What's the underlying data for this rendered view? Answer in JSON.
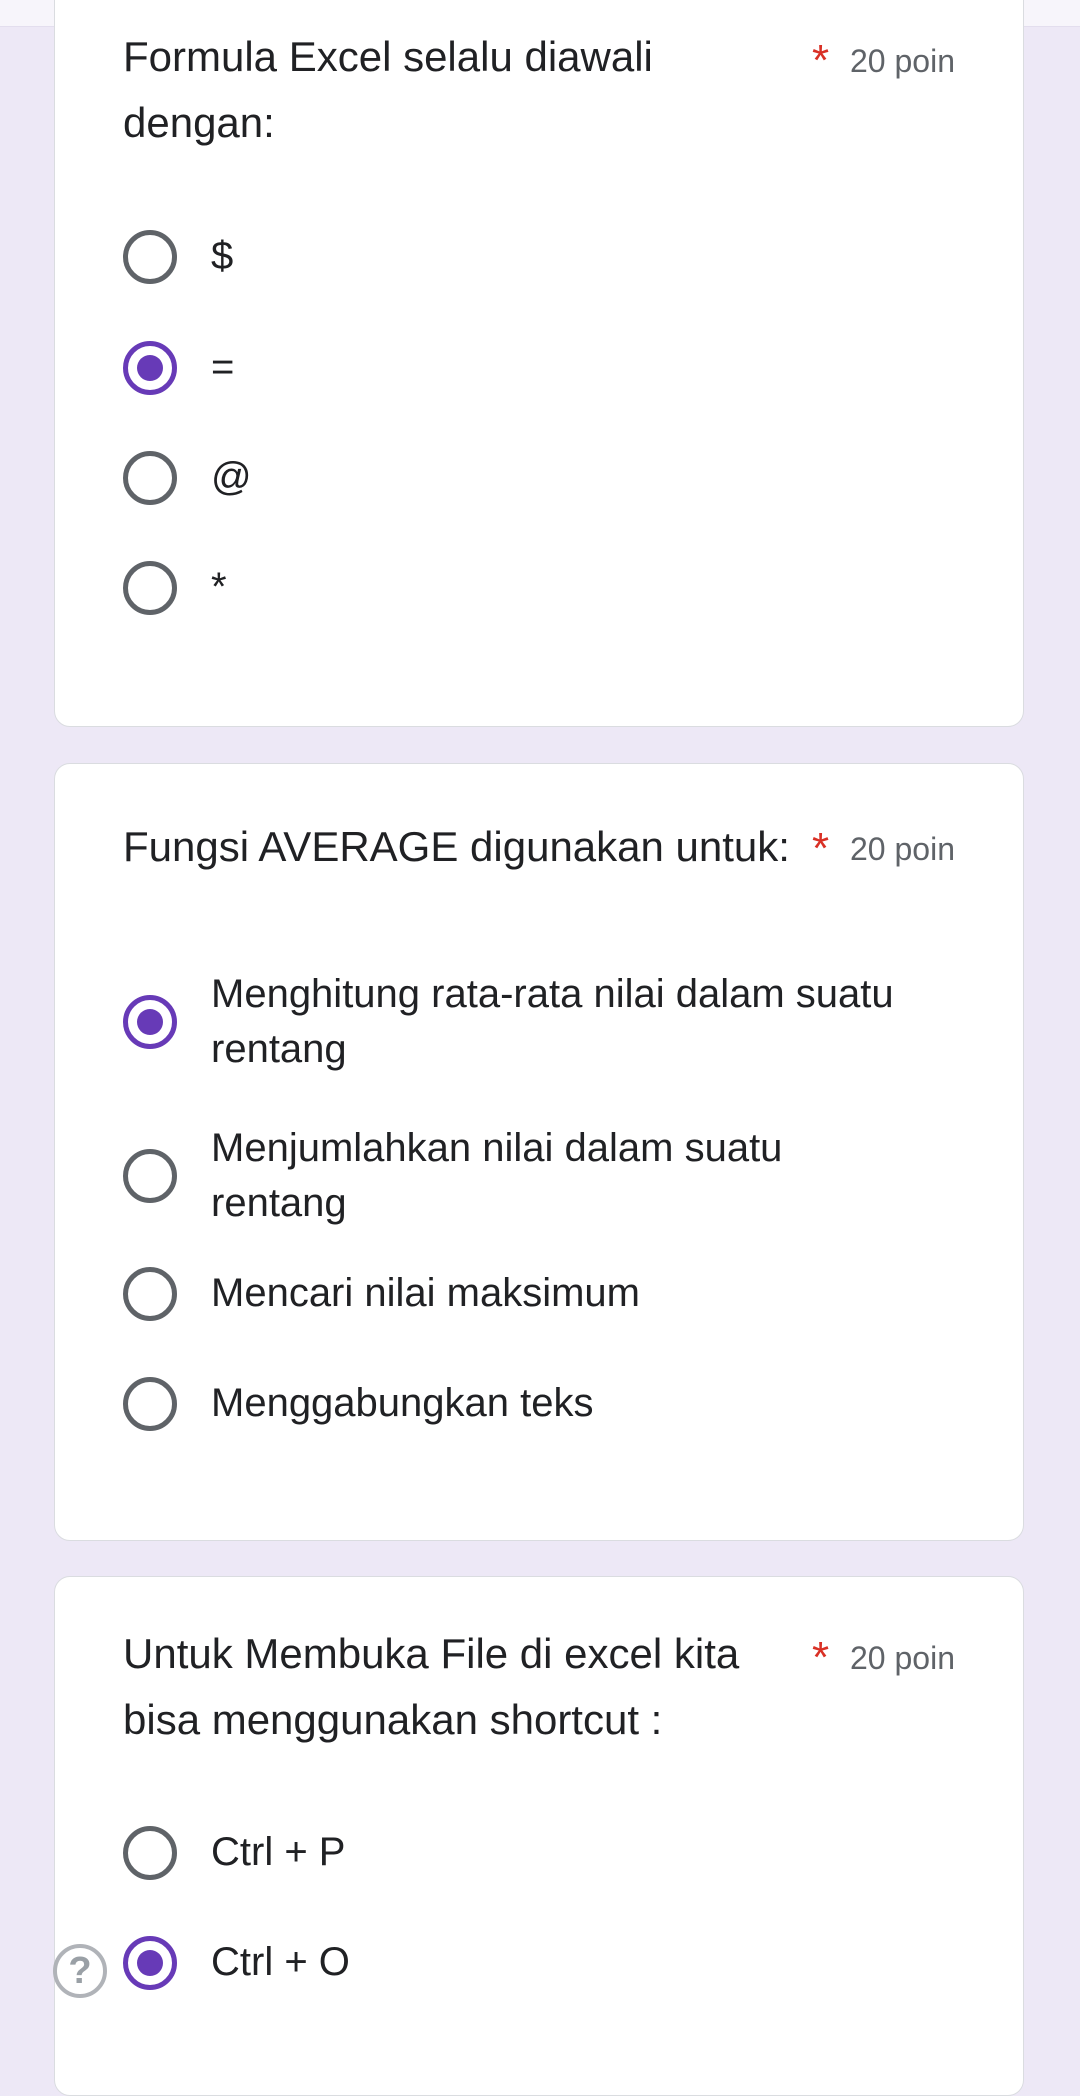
{
  "colors": {
    "accent": "#673ab7",
    "required": "#d93025",
    "background": "#ede8f6"
  },
  "questions": [
    {
      "text": "Formula Excel selalu diawali dengan:",
      "required_mark": "*",
      "points": "20 poin",
      "options": [
        {
          "label": "$",
          "selected": false
        },
        {
          "label": "=",
          "selected": true
        },
        {
          "label": "@",
          "selected": false
        },
        {
          "label": "*",
          "selected": false
        }
      ]
    },
    {
      "text": "Fungsi AVERAGE digunakan untuk:",
      "required_mark": "*",
      "points": "20 poin",
      "options": [
        {
          "label": "Menghitung rata-rata nilai dalam suatu rentang",
          "selected": true
        },
        {
          "label": "Menjumlahkan nilai dalam suatu rentang",
          "selected": false
        },
        {
          "label": "Mencari nilai maksimum",
          "selected": false
        },
        {
          "label": "Menggabungkan teks",
          "selected": false
        }
      ]
    },
    {
      "text": "Untuk Membuka File di excel kita bisa menggunakan shortcut :",
      "required_mark": "*",
      "points": "20 poin",
      "options": [
        {
          "label": "Ctrl + P",
          "selected": false
        },
        {
          "label": "Ctrl + O",
          "selected": true
        }
      ]
    }
  ],
  "help": {
    "icon": "question-mark-icon",
    "glyph": "?"
  }
}
